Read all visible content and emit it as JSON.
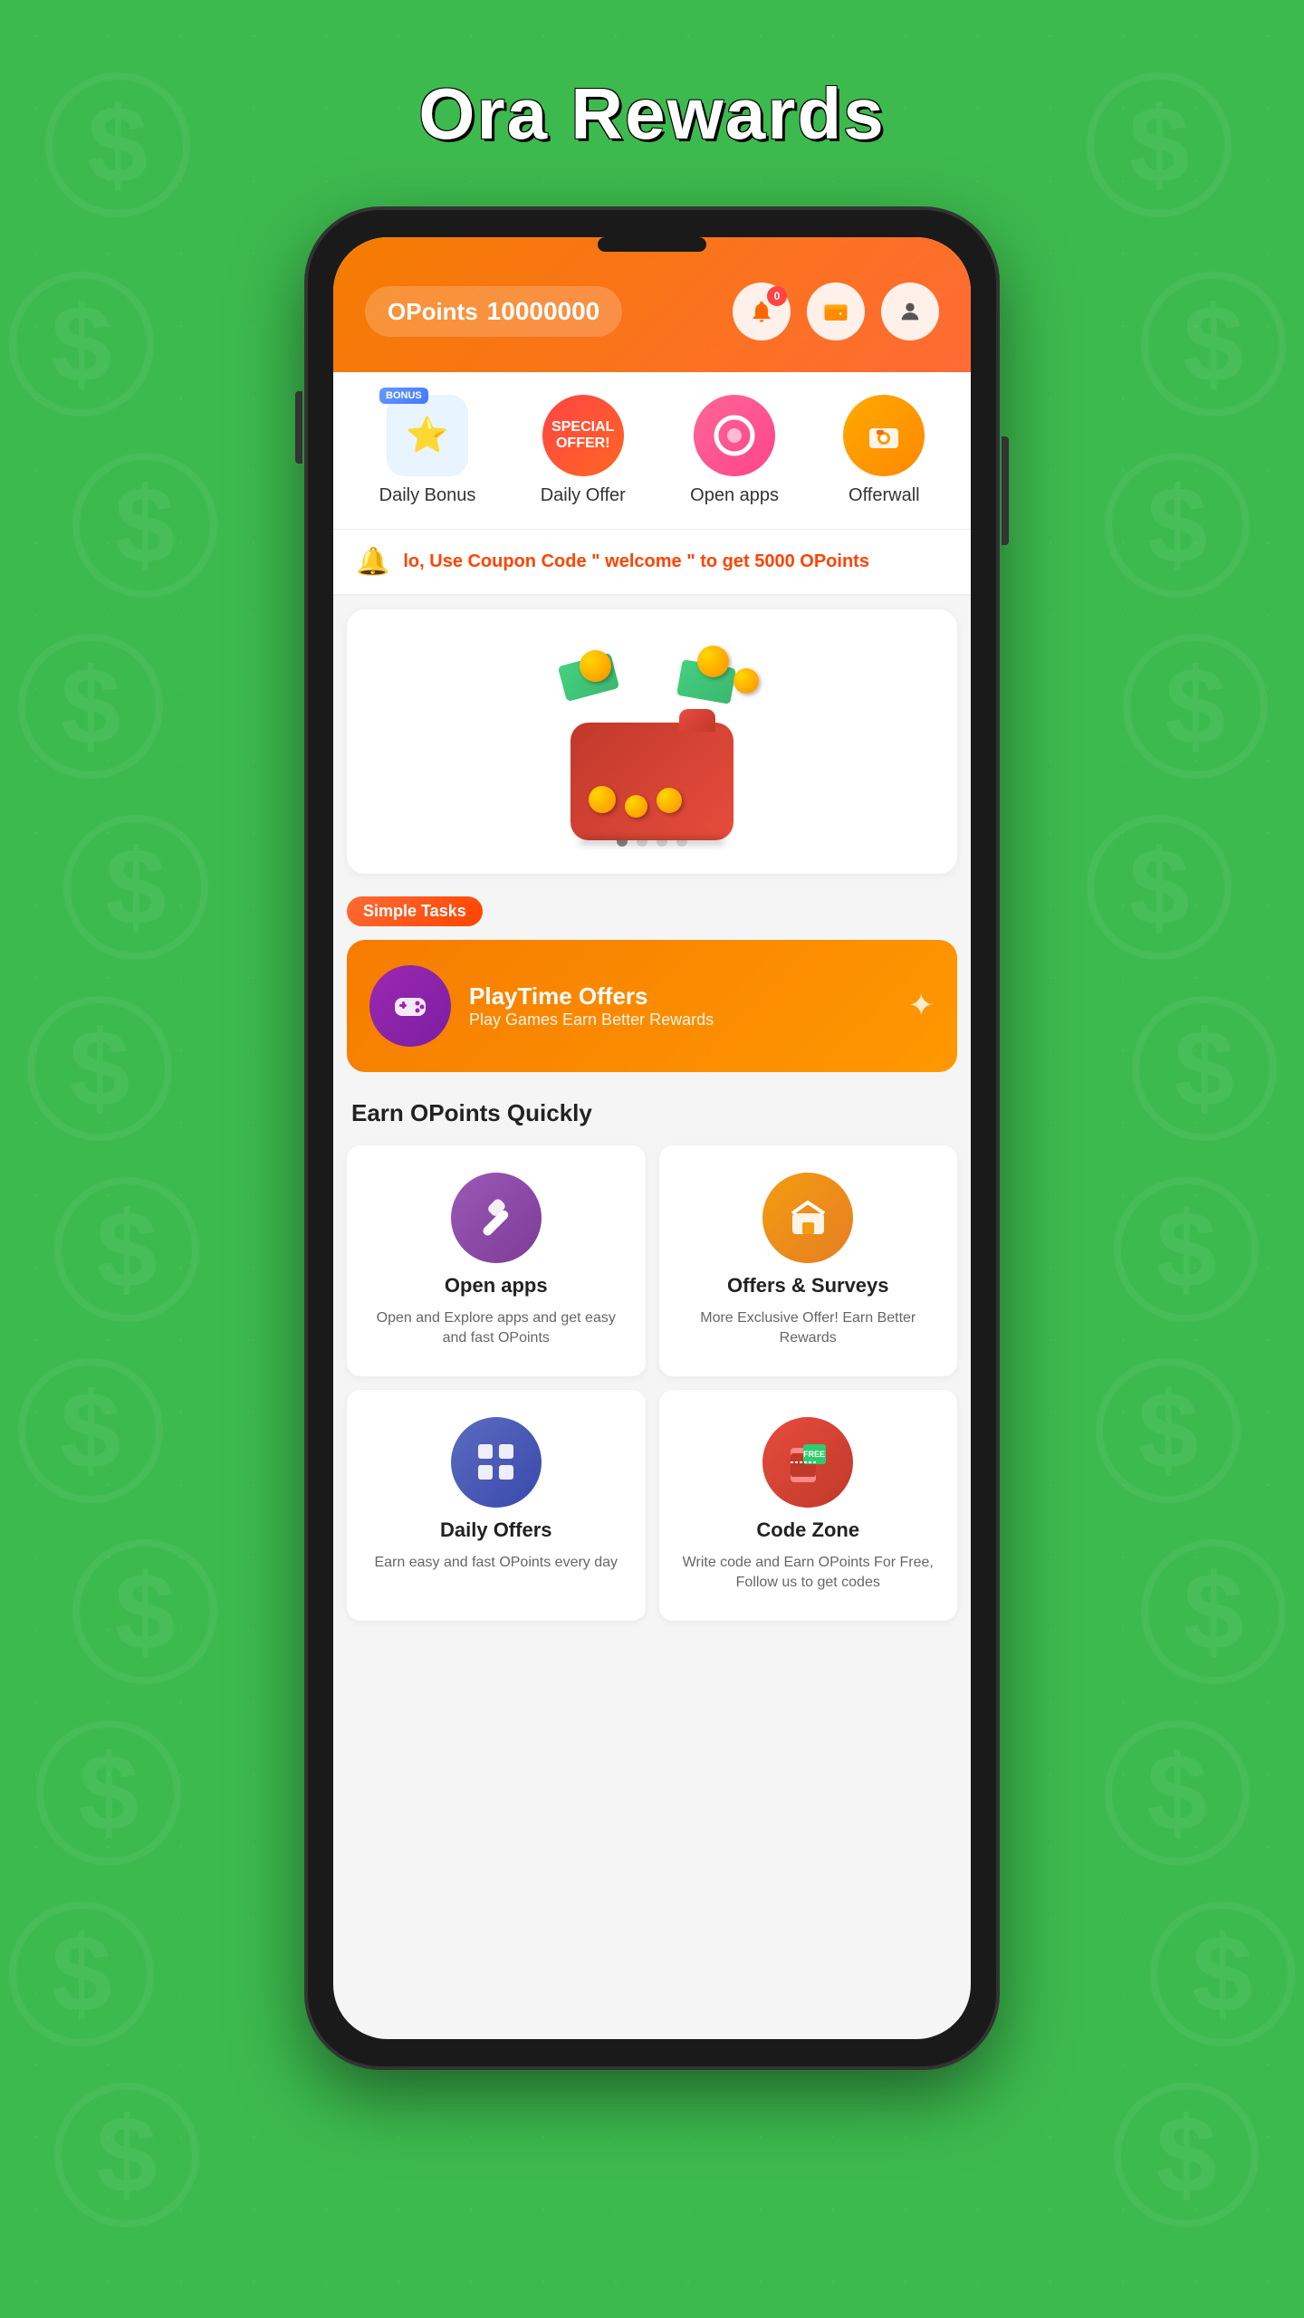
{
  "app": {
    "title": "Ora Rewards"
  },
  "header": {
    "points_label": "OPoints",
    "points_value": "10000000",
    "notification_count": "0",
    "wallet_icon": "wallet-icon",
    "profile_icon": "user-icon"
  },
  "quick_actions": [
    {
      "id": "daily-bonus",
      "label": "Daily Bonus",
      "badge": "BONUS",
      "icon": "⭐"
    },
    {
      "id": "daily-offer",
      "label": "Daily Offer",
      "icon": "🏷️",
      "special": "SPECIAL OFFER!"
    },
    {
      "id": "open-apps",
      "label": "Open apps",
      "icon": "⭕"
    },
    {
      "id": "offerwall",
      "label": "Offerwall",
      "icon": "🏪"
    }
  ],
  "notification": {
    "text": "lo, Use Coupon Code \" welcome \" to get 5000 OPoints"
  },
  "banner": {
    "dots": [
      {
        "active": true
      },
      {
        "active": false
      },
      {
        "active": false
      },
      {
        "active": false
      }
    ]
  },
  "simple_tasks": {
    "tag": "Simple Tasks",
    "playtime": {
      "title": "PlayTime Offers",
      "description": "Play Games Earn Better Rewards"
    }
  },
  "earn_section": {
    "title": "Earn OPoints Quickly",
    "cards": [
      {
        "id": "open-apps",
        "title": "Open apps",
        "description": "Open and Explore apps and get easy and fast OPoints",
        "color": "purple"
      },
      {
        "id": "offers-surveys",
        "title": "Offers & Surveys",
        "description": "More Exclusive Offer! Earn Better Rewards",
        "color": "orange"
      },
      {
        "id": "daily-offers",
        "title": "Daily Offers",
        "description": "Earn easy and fast OPoints every day",
        "color": "purple2"
      },
      {
        "id": "code-zone",
        "title": "Code Zone",
        "description": "Write code and Earn OPoints For Free, Follow us to get codes",
        "color": "red"
      }
    ]
  }
}
